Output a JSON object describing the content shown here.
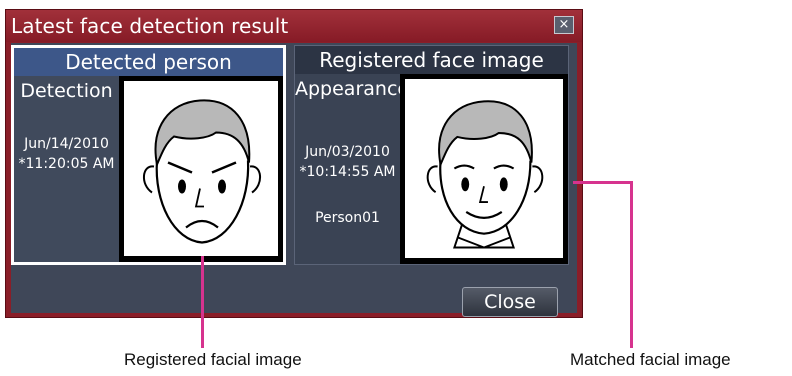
{
  "dialog": {
    "title": "Latest face detection result",
    "close_glyph": "×",
    "close_button_label": "Close"
  },
  "detected_panel": {
    "header": "Detected person",
    "info_title": "Detection",
    "date": "Jun/14/2010",
    "time": "*11:20:05 AM",
    "face_icon": "frowning-face-icon"
  },
  "registered_panel": {
    "header": "Registered face image",
    "info_title": "Appearance",
    "date": "Jun/03/2010",
    "time": "*10:14:55 AM",
    "person_name": "Person01",
    "face_icon": "smiling-face-icon"
  },
  "callouts": {
    "left_label": "Registered facial image",
    "right_label": "Matched facial image",
    "line_color": "#d6338e"
  },
  "colors": {
    "dialog_frame": "#8a1e28",
    "selected_header": "#3d5789",
    "panel_bg": "#2c3444"
  }
}
